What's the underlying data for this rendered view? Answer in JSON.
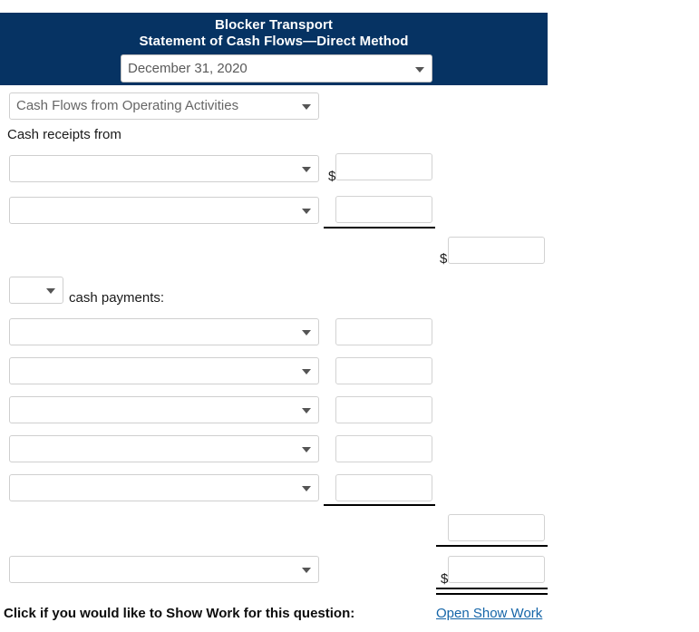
{
  "header": {
    "company": "Blocker Transport",
    "statement_title": "Statement of Cash Flows—Direct Method",
    "date_select_value": "December 31, 2020",
    "band_color": "#063363"
  },
  "section": {
    "activity_select_value": "Cash Flows from Operating Activities",
    "receipts_label": "Cash receipts from",
    "payments_qualifier_select_value": "",
    "payments_label": "cash payments:"
  },
  "receipt_rows": [
    {
      "account_select_value": "",
      "amount_value": "",
      "dollar_sign": "$"
    },
    {
      "account_select_value": "",
      "amount_value": "",
      "dollar_sign": ""
    }
  ],
  "receipts_subtotal": {
    "amount_value": "",
    "dollar_sign": "$"
  },
  "payment_rows": [
    {
      "account_select_value": "",
      "amount_value": ""
    },
    {
      "account_select_value": "",
      "amount_value": ""
    },
    {
      "account_select_value": "",
      "amount_value": ""
    },
    {
      "account_select_value": "",
      "amount_value": ""
    },
    {
      "account_select_value": "",
      "amount_value": ""
    }
  ],
  "payments_subtotal": {
    "amount_value": ""
  },
  "net_row": {
    "account_select_value": "",
    "amount_value": "",
    "dollar_sign": "$"
  },
  "footer": {
    "show_work_prompt": "Click if you would like to Show Work for this question:",
    "show_work_link": "Open Show Work",
    "link_color": "#1565a8"
  }
}
